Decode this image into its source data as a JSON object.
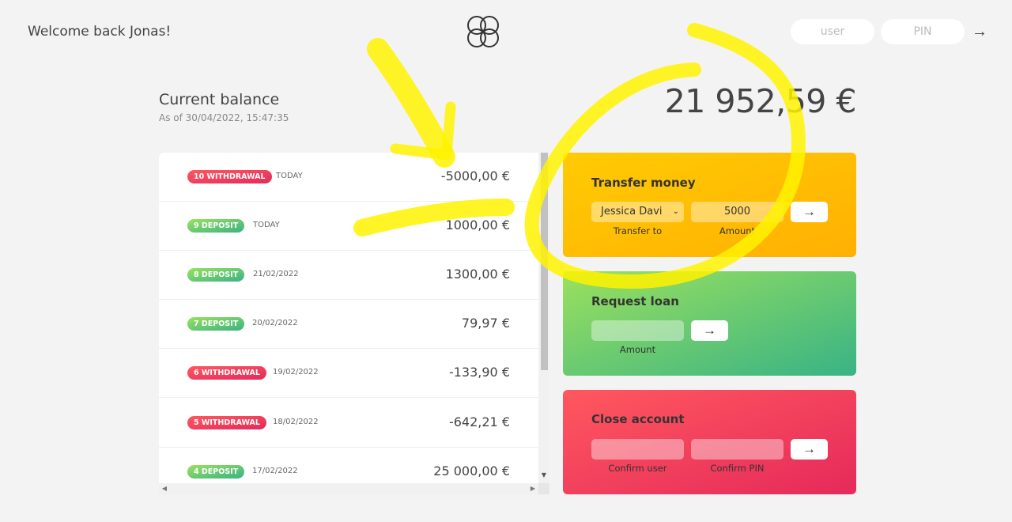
{
  "nav": {
    "welcome": "Welcome back Jonas!",
    "user_placeholder": "user",
    "pin_placeholder": "PIN",
    "login_icon": "arrow-right-icon",
    "login_arrow": "→"
  },
  "balance": {
    "label": "Current balance",
    "date": "As of 30/04/2022, 15:47:35",
    "value": "21 952,59 €"
  },
  "movements": [
    {
      "type": "10 WITHDRAWAL",
      "kind": "withdrawal",
      "date": "TODAY",
      "value": "-5000,00 €"
    },
    {
      "type": "9 DEPOSIT",
      "kind": "deposit",
      "date": "TODAY",
      "value": "1000,00 €"
    },
    {
      "type": "8 DEPOSIT",
      "kind": "deposit",
      "date": "21/02/2022",
      "value": "1300,00 €"
    },
    {
      "type": "7 DEPOSIT",
      "kind": "deposit",
      "date": "20/02/2022",
      "value": "79,97 €"
    },
    {
      "type": "6 WITHDRAWAL",
      "kind": "withdrawal",
      "date": "19/02/2022",
      "value": "-133,90 €"
    },
    {
      "type": "5 WITHDRAWAL",
      "kind": "withdrawal",
      "date": "18/02/2022",
      "value": "-642,21 €"
    },
    {
      "type": "4 DEPOSIT",
      "kind": "deposit",
      "date": "17/02/2022",
      "value": "25 000,00 €"
    }
  ],
  "transfer": {
    "title": "Transfer money",
    "to_value": "Jessica Davi",
    "amount_value": "5000",
    "to_label": "Transfer to",
    "amount_label": "Amount",
    "button": "→"
  },
  "loan": {
    "title": "Request loan",
    "amount_label": "Amount",
    "button": "→"
  },
  "close": {
    "title": "Close account",
    "user_label": "Confirm user",
    "pin_label": "Confirm PIN",
    "button": "→"
  },
  "colors": {
    "deposit": "#39b385",
    "withdrawal": "#e52a5a",
    "transfer": "#ffb003",
    "highlighter": "#fff200"
  },
  "icons": {
    "logo": "four-circles-logo-icon",
    "scroll_down": "triangle-down-icon",
    "scroll_left": "triangle-left-icon",
    "scroll_right": "triangle-right-icon",
    "select_chevron": "chevron-down-icon"
  }
}
